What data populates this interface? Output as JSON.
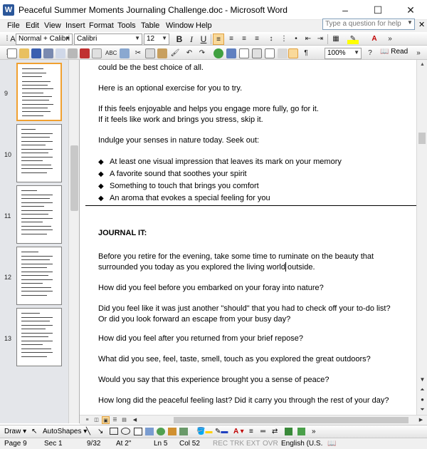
{
  "window": {
    "title": "Peaceful Summer Moments Journaling Challenge.doc - Microsoft Word",
    "app_icon": "W",
    "controls": {
      "minimize": "–",
      "maximize": "☐",
      "close": "✕"
    }
  },
  "menu": {
    "items": [
      "File",
      "Edit",
      "View",
      "Insert",
      "Format",
      "Tools",
      "Table",
      "Window",
      "Help"
    ],
    "help_placeholder": "Type a question for help"
  },
  "formatting_toolbar": {
    "style": "Normal + Calibri",
    "font": "Calibri",
    "size": "12",
    "bold": "B",
    "italic": "I",
    "underline": "U"
  },
  "standard_toolbar": {
    "zoom": "100%",
    "read_label": "Read"
  },
  "thumbnails": [
    {
      "page": "9",
      "selected": true
    },
    {
      "page": "10",
      "selected": false
    },
    {
      "page": "11",
      "selected": false
    },
    {
      "page": "12",
      "selected": false
    },
    {
      "page": "13",
      "selected": false
    }
  ],
  "document": {
    "top_lines": [
      "could be the best choice of all.",
      "Here is an optional exercise for you to try.",
      "If this feels enjoyable and helps you engage more fully, go for it.",
      "If it feels like work and brings you stress, skip it.",
      "Indulge your senses in nature today. Seek out:"
    ],
    "bullet_symbol": "◆",
    "bullets": [
      "At least one visual impression that leaves its mark on your memory",
      "A favorite sound that soothes your spirit",
      "Something to touch that brings you comfort",
      "An aroma that evokes a special feeling for you"
    ],
    "heading": "JOURNAL IT:",
    "body_lines": [
      "Before you retire for the evening, take some time to ruminate on the beauty that",
      "surrounded you today as you explored the living world outside.",
      "How did you feel before you embarked on your foray into nature?",
      "Did you feel like it was just another \"should\" that you had to check off your to-do list?",
      "Or did you look forward an escape from your busy day?",
      "How did you feel after you returned from your brief repose?",
      "What did you see, feel, taste, smell, touch as you explored the great outdoors?",
      "Would you say that this experience brought you a sense of peace?",
      "How long did the peaceful feeling last? Did it carry you through the rest of your day?"
    ]
  },
  "drawing_toolbar": {
    "draw_label": "Draw",
    "autoshapes_label": "AutoShapes"
  },
  "status": {
    "page": "Page 9",
    "section": "Sec 1",
    "page_of": "9/32",
    "at": "At 2\"",
    "line": "Ln 5",
    "col": "Col 52",
    "rec": "REC",
    "trk": "TRK",
    "ext": "EXT",
    "ovr": "OVR",
    "language": "English (U.S."
  },
  "colors": {
    "selection_border": "#f0a030",
    "word_blue": "#2b579a",
    "toolbar_active": "#f9d99a"
  }
}
